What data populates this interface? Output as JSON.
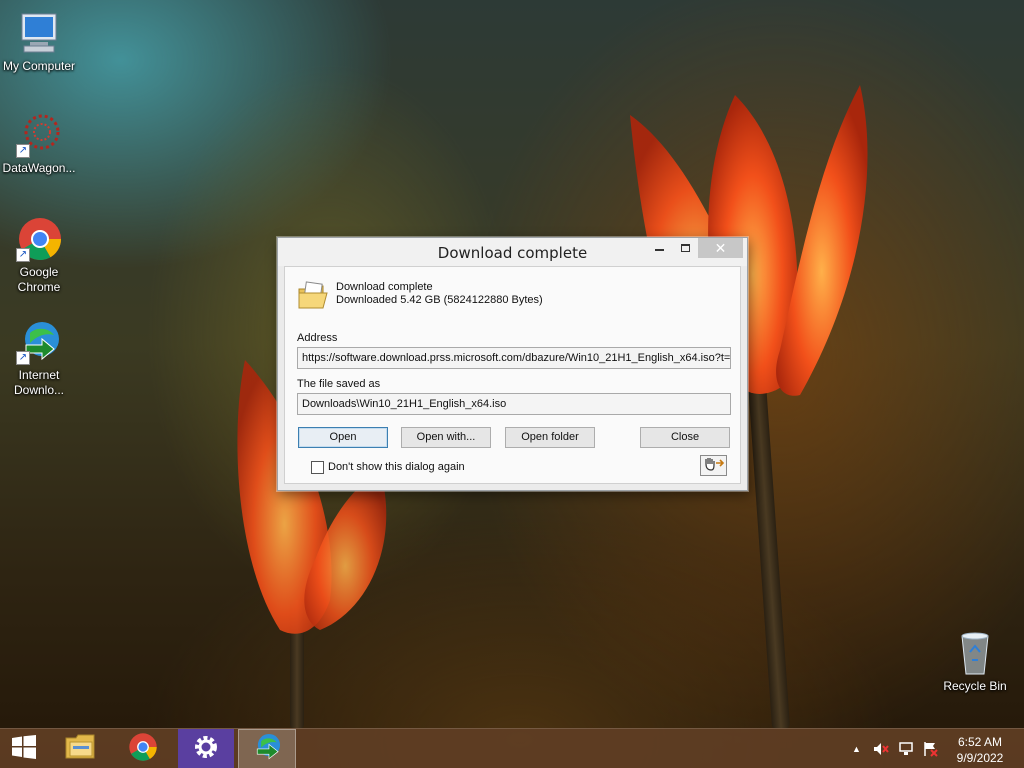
{
  "desktop": {
    "icons": [
      {
        "label": "My Computer"
      },
      {
        "label": "DataWagon..."
      },
      {
        "label": "Google Chrome"
      },
      {
        "label": "Internet Downlo..."
      },
      {
        "label": "Recycle Bin"
      }
    ]
  },
  "dialog": {
    "title": "Download complete",
    "message_line1": "Download complete",
    "message_line2": "Downloaded 5.42  GB (5824122880 Bytes)",
    "address_label": "Address",
    "address_value": "https://software.download.prss.microsoft.com/dbazure/Win10_21H1_English_x64.iso?t=",
    "saved_label": "The file saved as",
    "saved_value": "Downloads\\Win10_21H1_English_x64.iso",
    "buttons": {
      "open": "Open",
      "open_with": "Open with...",
      "open_folder": "Open folder",
      "close": "Close"
    },
    "checkbox_label": "Don't show this dialog again",
    "checkbox_checked": false
  },
  "taskbar": {
    "items": [
      "start-icon",
      "file-explorer-icon",
      "chrome-icon",
      "settings-icon",
      "internet-download-manager-icon"
    ],
    "active_item": "internet-download-manager-icon",
    "clock_time": "6:52 AM",
    "clock_date": "9/9/2022"
  },
  "colors": {
    "taskbar": "#603e24",
    "dialog_bg": "#ebebeb",
    "default_button_border": "#3c7fb1"
  }
}
